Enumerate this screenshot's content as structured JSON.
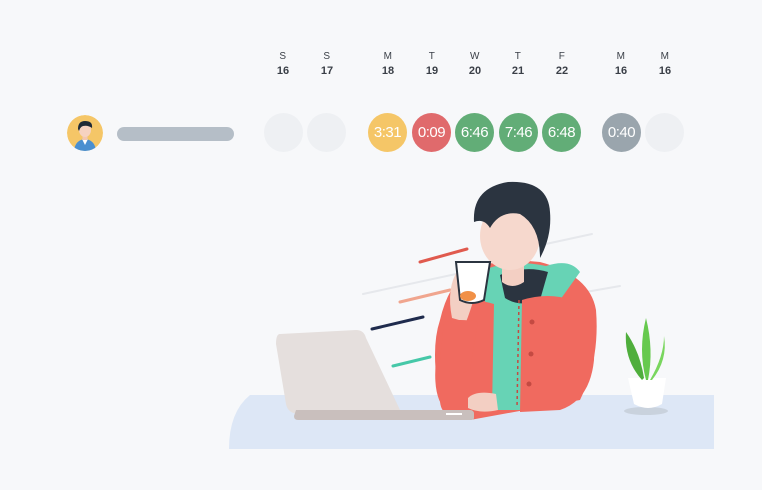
{
  "days": [
    {
      "letter": "S",
      "number": "16"
    },
    {
      "letter": "S",
      "number": "17"
    },
    {
      "letter": "M",
      "number": "18"
    },
    {
      "letter": "T",
      "number": "19"
    },
    {
      "letter": "W",
      "number": "20"
    },
    {
      "letter": "T",
      "number": "21"
    },
    {
      "letter": "F",
      "number": "22"
    },
    {
      "letter": "M",
      "number": "16"
    },
    {
      "letter": "M",
      "number": "16"
    }
  ],
  "entries": [
    {
      "time": "",
      "color": "#eef0f3"
    },
    {
      "time": "",
      "color": "#eef0f3"
    },
    {
      "time": "3:31",
      "color": "#f5c667"
    },
    {
      "time": "0:09",
      "color": "#e06a6c"
    },
    {
      "time": "6:46",
      "color": "#62ad77"
    },
    {
      "time": "7:46",
      "color": "#62ad77"
    },
    {
      "time": "6:48",
      "color": "#62ad77"
    },
    {
      "time": "0:40",
      "color": "#9aa5ad"
    },
    {
      "time": "",
      "color": "#eef0f3"
    }
  ],
  "icons": {
    "avatar": "user-avatar-icon",
    "illustration": "person-drinking-coffee-at-laptop-illustration",
    "plant": "potted-plant-icon"
  }
}
